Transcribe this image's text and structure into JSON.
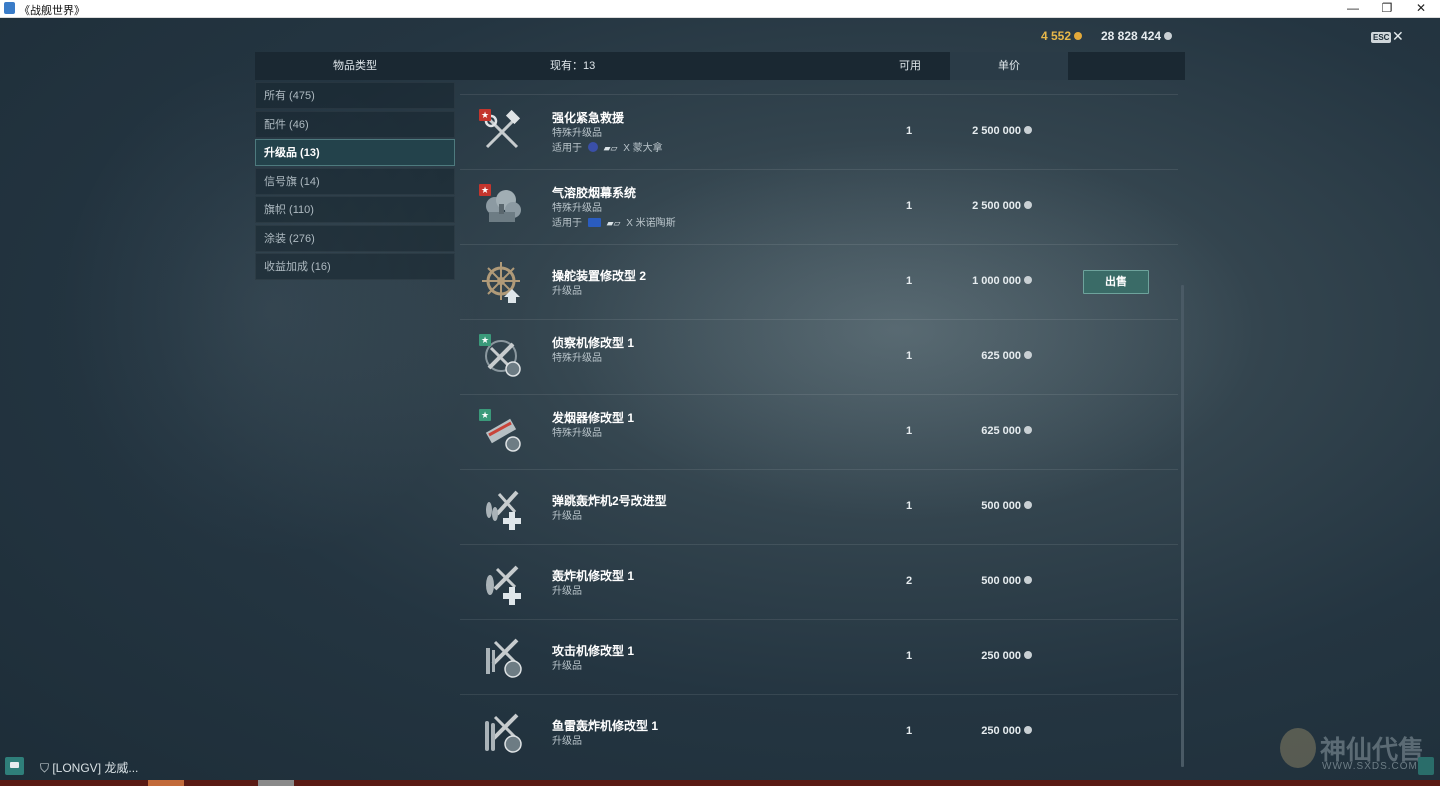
{
  "window": {
    "title": "《战舰世界》",
    "controls": [
      "—",
      "❐",
      "✕"
    ]
  },
  "currency": {
    "gold": "4 552",
    "silver": "28 828 424"
  },
  "esc_label": "ESC",
  "header": {
    "category_col": "物品类型",
    "current_label": "现有：",
    "current_count": "13",
    "available_col": "可用",
    "price_col": "单价"
  },
  "categories": [
    {
      "label": "所有 (475)"
    },
    {
      "label": "配件 (46)"
    },
    {
      "label": "升级品 (13)"
    },
    {
      "label": "信号旗 (14)"
    },
    {
      "label": "旗帜 (110)"
    },
    {
      "label": "涂装 (276)"
    },
    {
      "label": "收益加成 (16)"
    }
  ],
  "items": [
    {
      "name": "强化紧急救援",
      "type": "特殊升级品",
      "applies_label": "适用于",
      "applies_ship": "X 蒙大拿",
      "qty": "1",
      "price": "2 500 000",
      "icon": "hammer-wrench-icon"
    },
    {
      "name": "气溶胶烟幕系统",
      "type": "特殊升级品",
      "applies_label": "适用于",
      "applies_ship": "X 米诺陶斯",
      "qty": "1",
      "price": "2 500 000",
      "icon": "smoke-screen-icon"
    },
    {
      "name": "操舵装置修改型 2",
      "type": "升级品",
      "qty": "1",
      "price": "1 000 000",
      "icon": "ship-wheel-icon",
      "action": "出售"
    },
    {
      "name": "侦察机修改型 1",
      "type": "特殊升级品",
      "qty": "1",
      "price": "625 000",
      "icon": "spotter-plane-icon"
    },
    {
      "name": "发烟器修改型 1",
      "type": "特殊升级品",
      "qty": "1",
      "price": "625 000",
      "icon": "smoke-generator-icon"
    },
    {
      "name": "弹跳轰炸机2号改进型",
      "type": "升级品",
      "qty": "1",
      "price": "500 000",
      "icon": "skip-bomber-icon"
    },
    {
      "name": "轰炸机修改型 1",
      "type": "升级品",
      "qty": "2",
      "price": "500 000",
      "icon": "bomber-icon"
    },
    {
      "name": "攻击机修改型 1",
      "type": "升级品",
      "qty": "1",
      "price": "250 000",
      "icon": "attack-aircraft-icon"
    },
    {
      "name": "鱼雷轰炸机修改型 1",
      "type": "升级品",
      "qty": "1",
      "price": "250 000",
      "icon": "torpedo-bomber-icon"
    }
  ],
  "chat": {
    "text": "[LONGV]  龙威..."
  },
  "watermark": {
    "text": "神仙代售",
    "url": "WWW.SXDS.COM"
  },
  "colors": {
    "gold": "#e8b84a",
    "accent_teal": "#3a6b67",
    "background": "#243541"
  }
}
